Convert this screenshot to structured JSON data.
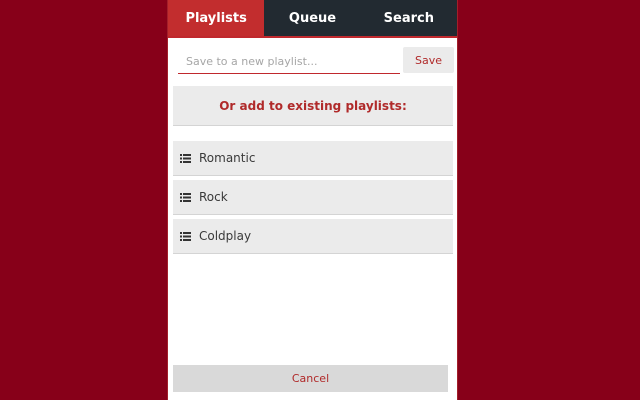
{
  "tabs": [
    {
      "label": "Playlists",
      "active": true
    },
    {
      "label": "Queue",
      "active": false
    },
    {
      "label": "Search",
      "active": false
    }
  ],
  "save": {
    "placeholder": "Save to a new playlist...",
    "value": "",
    "button_label": "Save"
  },
  "existing_header": "Or add to existing playlists:",
  "playlists": [
    {
      "label": "Romantic",
      "icon": "list-icon"
    },
    {
      "label": "Rock",
      "icon": "list-icon"
    },
    {
      "label": "Coldplay",
      "icon": "list-icon"
    }
  ],
  "cancel_label": "Cancel",
  "colors": {
    "background": "#870019",
    "accent": "#c22d2e",
    "tab_bar": "#222a31",
    "accent_text": "#b02a2a"
  }
}
